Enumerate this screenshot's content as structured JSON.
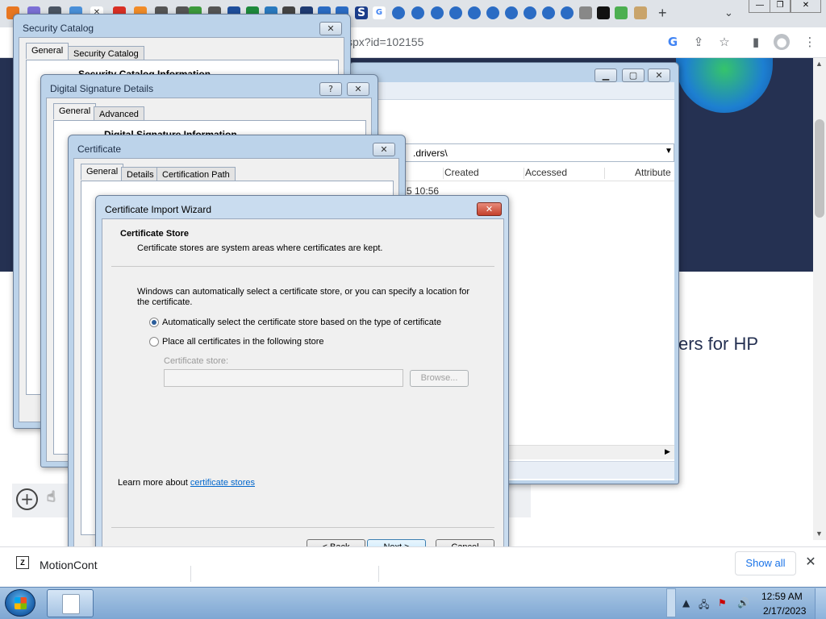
{
  "browser": {
    "url_fragment": "spx?id=102155",
    "new_tab_symbol": "+",
    "window_controls": [
      "—",
      "❐",
      "✕"
    ]
  },
  "page": {
    "heading_fragment": "vers for HP"
  },
  "downloads": {
    "item_name": "MotionCont",
    "show_all": "Show all",
    "close_symbol": "✕"
  },
  "security_catalog": {
    "title": "Security Catalog",
    "tabs": [
      "General",
      "Security Catalog"
    ],
    "info_heading": "Security Catalog Information"
  },
  "digital_signature": {
    "title": "Digital Signature Details",
    "tabs": [
      "General",
      "Advanced"
    ],
    "info_heading": "Digital Signature Information"
  },
  "certificate": {
    "title": "Certificate",
    "tabs": [
      "General",
      "Details",
      "Certification Path"
    ]
  },
  "explorer": {
    "path": ".drivers\\",
    "columns": [
      "Created",
      "Accessed",
      "Attribute"
    ],
    "first_row_created": "5 10:56"
  },
  "wizard": {
    "title": "Certificate Import Wizard",
    "section_title": "Certificate Store",
    "section_desc": "Certificate stores are system areas where certificates are kept.",
    "intro": "Windows can automatically select a certificate store, or you can specify a location for the certificate.",
    "option_auto": "Automatically select the certificate store based on the type of certificate",
    "option_manual": "Place all certificates in the following store",
    "store_label": "Certificate store:",
    "store_value": "",
    "browse": "Browse...",
    "learn_more_prefix": "Learn more about ",
    "learn_more_link": "certificate stores",
    "back": "< Back",
    "next": "Next >",
    "cancel": "Cancel"
  },
  "taskbar": {
    "time": "12:59 AM",
    "date": "2/17/2023"
  }
}
